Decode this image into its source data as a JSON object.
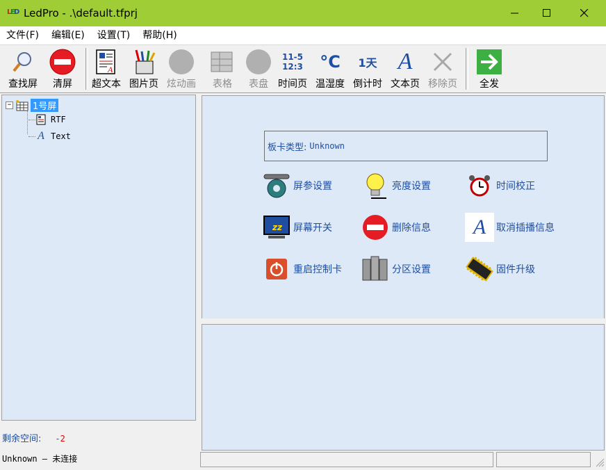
{
  "window": {
    "title": "LedPro - .\\default.tfprj",
    "logo_letters": [
      "L",
      "E",
      "D"
    ],
    "accent_color": "#9ecd36"
  },
  "menu": [
    "文件(F)",
    "编辑(E)",
    "设置(T)",
    "帮助(H)"
  ],
  "toolbar": {
    "find_screen": "查找屏",
    "clear_screen": "清屏",
    "super_text": "超文本",
    "picture_page": "图片页",
    "animation": "炫动画",
    "table": "表格",
    "dial": "表盘",
    "time_page": "时间页",
    "time_icon_top": "11-5",
    "time_icon_bottom": "12:3",
    "temp_humidity": "温湿度",
    "temp_icon": "°C",
    "countdown": "倒计时",
    "countdown_icon": "1天",
    "text_page": "文本页",
    "text_icon": "A",
    "remove_page": "移除页",
    "send_all": "全发"
  },
  "tree": {
    "screen_label": "1号屏",
    "expand_symbol": "−",
    "children": [
      "RTF",
      "Text"
    ]
  },
  "free_space": {
    "label": "剩余空间:",
    "value": "-2"
  },
  "main": {
    "board_type_label": "板卡类型:",
    "board_type_value": "Unknown",
    "buttons": {
      "screen_params": "屏参设置",
      "brightness": "亮度设置",
      "time_calibration": "时间校正",
      "screen_switch": "屏幕开关",
      "delete_info": "删除信息",
      "cancel_insert": "取消插播信息",
      "restart_card": "重启控制卡",
      "partition": "分区设置",
      "firmware": "固件升级"
    }
  },
  "status": {
    "connection": "Unknown — 未连接",
    "cell2": "",
    "cell3": ""
  }
}
